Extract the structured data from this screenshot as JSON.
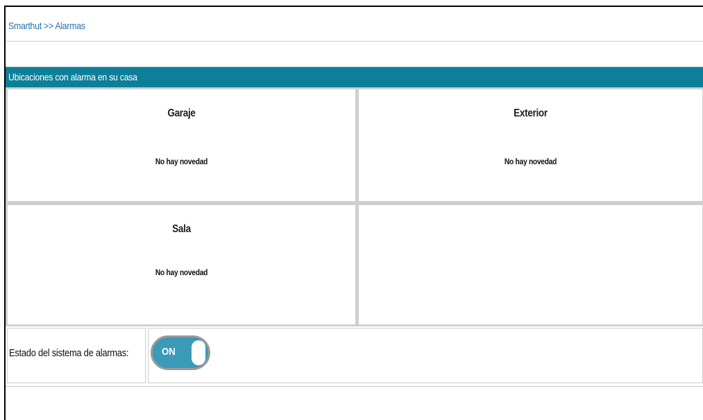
{
  "breadcrumb": "Smarthut >> Alarmas",
  "section": {
    "title": "Ubicaciones con alarma en su casa"
  },
  "locations": [
    {
      "name": "Garaje",
      "status": "No hay novedad"
    },
    {
      "name": "Exterior",
      "status": "No hay novedad"
    },
    {
      "name": "Sala",
      "status": "No hay novedad"
    }
  ],
  "alarm_system": {
    "label": "Estado del sistema de alarmas:",
    "toggle_text": "ON",
    "toggle_on": true
  },
  "colors": {
    "header_bg": "#0d7f98",
    "breadcrumb_text": "#2a6fa8",
    "toggle_bg": "#3a9ab7"
  }
}
